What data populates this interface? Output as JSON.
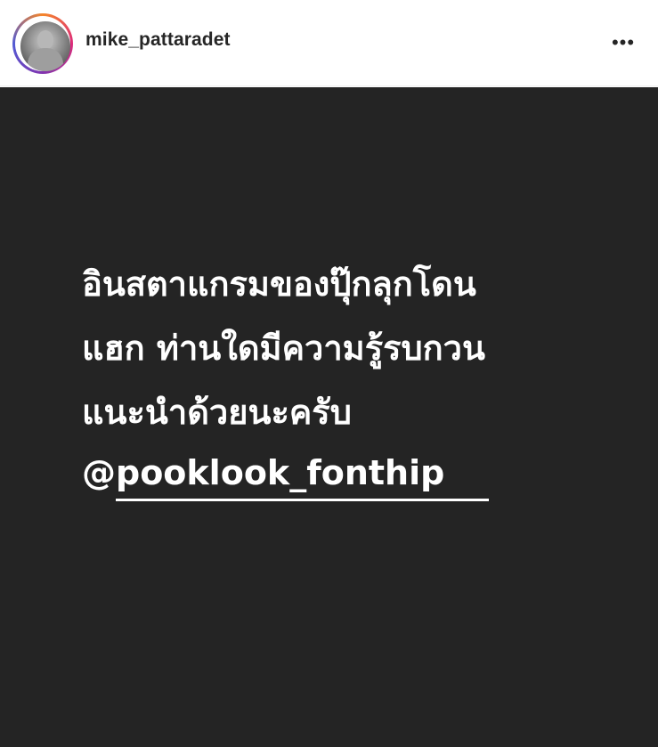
{
  "header": {
    "username": "mike_pattaradet",
    "more_icon": "more-horizontal-icon",
    "more_label": "•••"
  },
  "post": {
    "background_color": "#242424",
    "text_color": "#ffffff",
    "lines": [
      "อินสตาแกรมของปุ๊กลุกโดน",
      "แฮก ท่านใดมีความรู้รบกวน",
      "แนะนำด้วยนะครับ"
    ],
    "mention_prefix": "@",
    "mention_handle": "pooklook_fonthip"
  }
}
